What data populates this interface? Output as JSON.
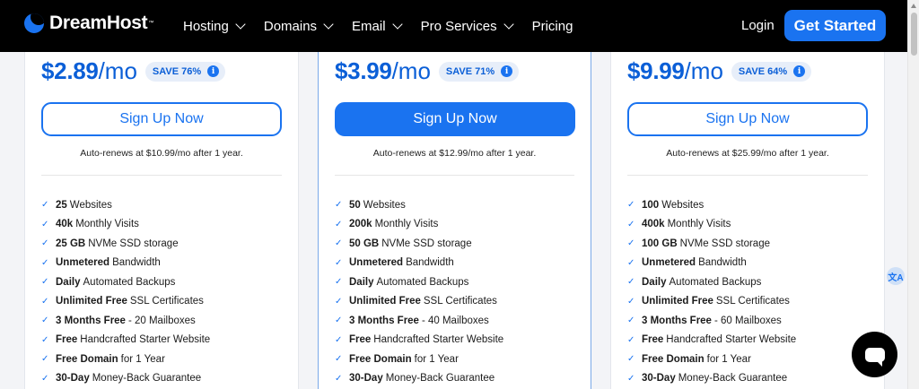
{
  "header": {
    "brand": "DreamHost",
    "nav": [
      {
        "label": "Hosting",
        "dropdown": true
      },
      {
        "label": "Domains",
        "dropdown": true
      },
      {
        "label": "Email",
        "dropdown": true
      },
      {
        "label": "Pro Services",
        "dropdown": true
      },
      {
        "label": "Pricing",
        "dropdown": false
      }
    ],
    "login": "Login",
    "cta": "Get Started"
  },
  "colors": {
    "accent": "#1a73f0",
    "price": "#0b5fd7",
    "header_bg": "#000000"
  },
  "plans": [
    {
      "price": "$2.89",
      "unit": "/mo",
      "save": "SAVE 76%",
      "signup": "Sign Up Now",
      "autorenew": "Auto-renews at $10.99/mo after 1 year.",
      "features": [
        {
          "bold": "25",
          "text": "Websites"
        },
        {
          "bold": "40k",
          "text": "Monthly Visits"
        },
        {
          "bold": "25 GB",
          "text": "NVMe SSD storage"
        },
        {
          "bold": "Unmetered",
          "text": "Bandwidth"
        },
        {
          "bold": "Daily",
          "text": "Automated Backups"
        },
        {
          "bold": "Unlimited Free",
          "text": "SSL Certificates"
        },
        {
          "bold": "3 Months Free",
          "text": "- 20 Mailboxes"
        },
        {
          "bold": "Free",
          "text": "Handcrafted Starter Website"
        },
        {
          "bold": "Free Domain",
          "text": "for 1 Year"
        },
        {
          "bold": "30-Day",
          "text": "Money-Back Guarantee"
        }
      ]
    },
    {
      "price": "$3.99",
      "unit": "/mo",
      "save": "SAVE 71%",
      "signup": "Sign Up Now",
      "autorenew": "Auto-renews at $12.99/mo after 1 year.",
      "features": [
        {
          "bold": "50",
          "text": "Websites"
        },
        {
          "bold": "200k",
          "text": "Monthly Visits"
        },
        {
          "bold": "50 GB",
          "text": "NVMe SSD storage"
        },
        {
          "bold": "Unmetered",
          "text": "Bandwidth"
        },
        {
          "bold": "Daily",
          "text": "Automated Backups"
        },
        {
          "bold": "Unlimited Free",
          "text": "SSL Certificates"
        },
        {
          "bold": "3 Months Free",
          "text": "- 40 Mailboxes"
        },
        {
          "bold": "Free",
          "text": "Handcrafted Starter Website"
        },
        {
          "bold": "Free Domain",
          "text": "for 1 Year"
        },
        {
          "bold": "30-Day",
          "text": "Money-Back Guarantee"
        }
      ]
    },
    {
      "price": "$9.99",
      "unit": "/mo",
      "save": "SAVE 64%",
      "signup": "Sign Up Now",
      "autorenew": "Auto-renews at $25.99/mo after 1 year.",
      "features": [
        {
          "bold": "100",
          "text": "Websites"
        },
        {
          "bold": "400k",
          "text": "Monthly Visits"
        },
        {
          "bold": "100 GB",
          "text": "NVMe SSD storage"
        },
        {
          "bold": "Unmetered",
          "text": "Bandwidth"
        },
        {
          "bold": "Daily",
          "text": "Automated Backups"
        },
        {
          "bold": "Unlimited Free",
          "text": "SSL Certificates"
        },
        {
          "bold": "3 Months Free",
          "text": "- 60 Mailboxes"
        },
        {
          "bold": "Free",
          "text": "Handcrafted Starter Website"
        },
        {
          "bold": "Free Domain",
          "text": "for 1 Year"
        },
        {
          "bold": "30-Day",
          "text": "Money-Back Guarantee"
        }
      ]
    }
  ],
  "icons": {
    "info": "info-icon",
    "check": "checkmark-icon",
    "chat": "chat-icon",
    "translate": "translate-icon"
  }
}
